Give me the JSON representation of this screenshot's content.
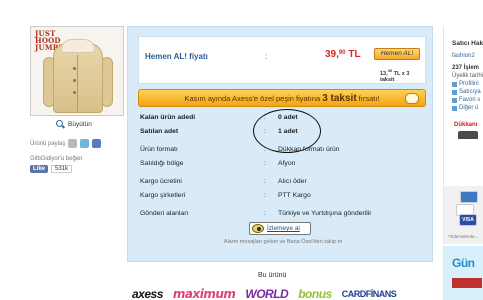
{
  "product": {
    "image_brand_text": "JUST HOOD JUMPER",
    "zoom_label": "Büyütün",
    "share_label": "Ürünü paylaş",
    "gittigidiyor_like_text": "GittiGidiyor'u beğen",
    "fb_like_label": "Like",
    "fb_like_count": "531k"
  },
  "price": {
    "label": "Hemen AL! fiyatı",
    "colon": ":",
    "value_main": "39,",
    "value_decimal": "90",
    "currency": "TL",
    "buy_button_label": "Hemen AL!",
    "installment_prefix": "13,",
    "installment_decimal": "30",
    "installment_suffix": "TL x 3 taksit"
  },
  "promo": {
    "text": "Kasım ayında Axess'e özel peşin fiyatına",
    "highlight": "3 taksit",
    "tail": "fırsatı!"
  },
  "details": [
    {
      "key": "Kalan ürün adedi",
      "colon": ":",
      "value": "0 adet",
      "bold": true
    },
    {
      "key": "Satılan adet",
      "colon": ":",
      "value": "1 adet",
      "bold": true
    },
    {
      "key": "Ürün formatı",
      "colon": ":",
      "value": "Dükkan formatı ürün",
      "bold": false
    },
    {
      "key": "Satıldığı bölge",
      "colon": ":",
      "value": "Afyon",
      "bold": false
    },
    {
      "key": "Kargo ücretini",
      "colon": ":",
      "value": "Alıcı öder",
      "bold": false
    },
    {
      "key": "Kargo şirketleri",
      "colon": ":",
      "value": "PTT Kargo",
      "bold": false
    },
    {
      "key": "Gönderi alanları",
      "colon": ":",
      "value": "Türkiye ve Yurtdışına gönderilir",
      "bold": false
    }
  ],
  "watch": {
    "button_label": "İzlemeye al",
    "note": "Alarm mesajları gelsin ve Bana Özel'den takip et"
  },
  "partners": {
    "heading": "Bu ürünü",
    "logos": [
      "axess",
      "maximum",
      "WORLD",
      "bonus",
      "CARDFİNANS"
    ]
  },
  "seller": {
    "title": "Satıcı Hakkında",
    "name": "fashion2",
    "stats": "237 İşlem",
    "since": "Üyelik tarihi",
    "links": [
      "Profilini",
      "Satıcıya",
      "Favori s",
      "Diğer ü"
    ],
    "store_label": "Dükkanı"
  },
  "payment_note": "*Ödemelerde...",
  "ad_text": "Gün"
}
